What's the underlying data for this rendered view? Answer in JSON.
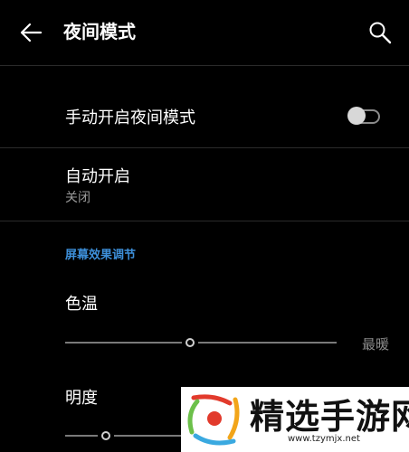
{
  "header": {
    "title": "夜间模式",
    "back_icon": "arrow-left-icon",
    "search_icon": "search-icon"
  },
  "manual_night_mode": {
    "label": "手动开启夜间模式",
    "enabled": false
  },
  "auto_enable": {
    "label": "自动开启",
    "value": "关闭"
  },
  "screen_effect_section": {
    "header": "屏幕效果调节",
    "color_temperature": {
      "label": "色温",
      "max_label": "最暖",
      "level": 0.46
    },
    "brightness": {
      "label": "明度",
      "level": 0.15
    }
  },
  "watermark": {
    "text": "精选手游网",
    "url": "www.tzymjx.net"
  },
  "colors": {
    "background": "#000000",
    "accent": "#3d8fd9",
    "secondary_text": "#9a9a9a"
  }
}
